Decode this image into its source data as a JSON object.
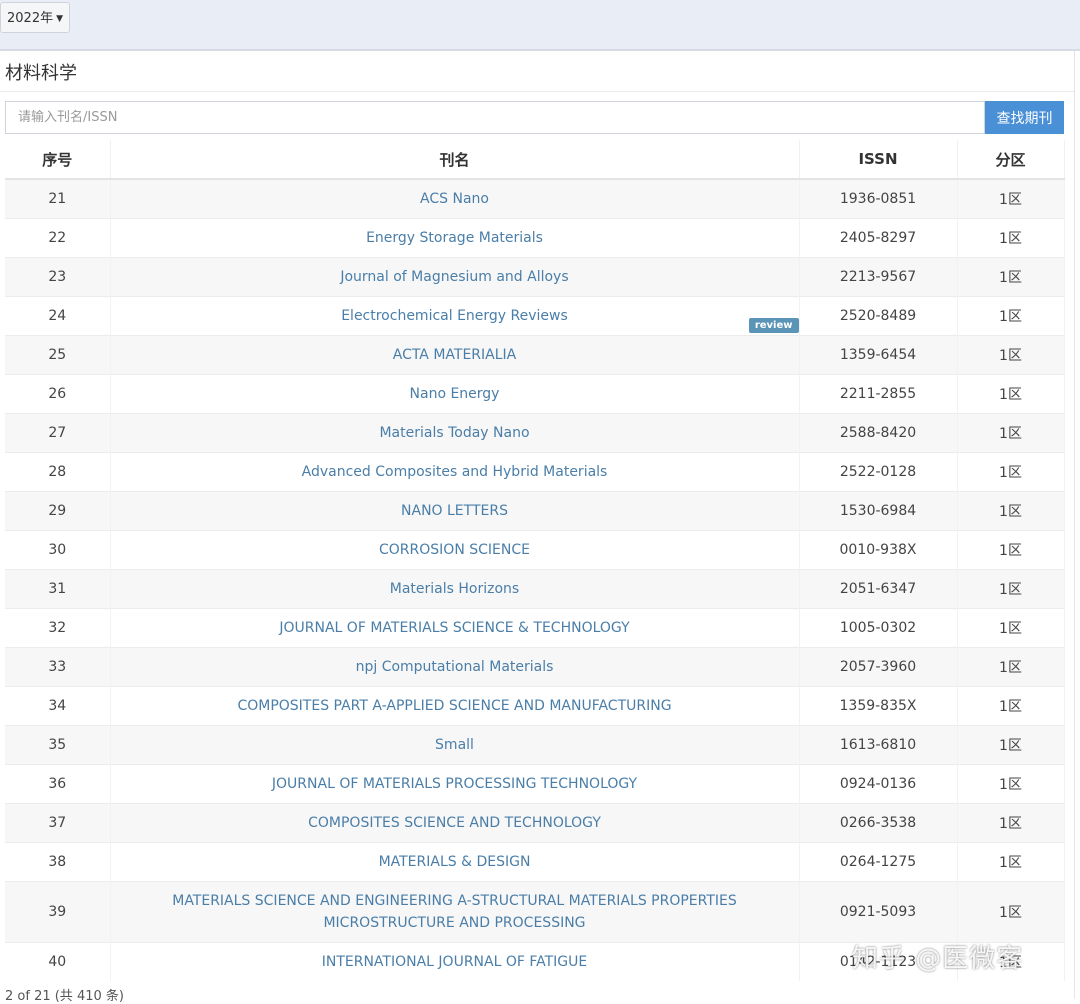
{
  "topbar": {
    "year_label": "2022年"
  },
  "panel": {
    "title": "材料科学"
  },
  "search": {
    "placeholder": "请输入刊名/ISSN",
    "button_label": "查找期刊"
  },
  "table": {
    "headers": {
      "index": "序号",
      "name": "刊名",
      "issn": "ISSN",
      "zone": "分区"
    },
    "rows": [
      {
        "index": "21",
        "name": "ACS Nano",
        "issn": "1936-0851",
        "zone": "1区"
      },
      {
        "index": "22",
        "name": "Energy Storage Materials",
        "issn": "2405-8297",
        "zone": "1区"
      },
      {
        "index": "23",
        "name": "Journal of Magnesium and Alloys",
        "issn": "2213-9567",
        "zone": "1区"
      },
      {
        "index": "24",
        "name": "Electrochemical Energy Reviews",
        "issn": "2520-8489",
        "zone": "1区",
        "badge": "review"
      },
      {
        "index": "25",
        "name": "ACTA MATERIALIA",
        "issn": "1359-6454",
        "zone": "1区"
      },
      {
        "index": "26",
        "name": "Nano Energy",
        "issn": "2211-2855",
        "zone": "1区"
      },
      {
        "index": "27",
        "name": "Materials Today Nano",
        "issn": "2588-8420",
        "zone": "1区"
      },
      {
        "index": "28",
        "name": "Advanced Composites and Hybrid Materials",
        "issn": "2522-0128",
        "zone": "1区"
      },
      {
        "index": "29",
        "name": "NANO LETTERS",
        "issn": "1530-6984",
        "zone": "1区"
      },
      {
        "index": "30",
        "name": "CORROSION SCIENCE",
        "issn": "0010-938X",
        "zone": "1区"
      },
      {
        "index": "31",
        "name": "Materials Horizons",
        "issn": "2051-6347",
        "zone": "1区"
      },
      {
        "index": "32",
        "name": "JOURNAL OF MATERIALS SCIENCE & TECHNOLOGY",
        "issn": "1005-0302",
        "zone": "1区"
      },
      {
        "index": "33",
        "name": "npj Computational Materials",
        "issn": "2057-3960",
        "zone": "1区"
      },
      {
        "index": "34",
        "name": "COMPOSITES PART A-APPLIED SCIENCE AND MANUFACTURING",
        "issn": "1359-835X",
        "zone": "1区"
      },
      {
        "index": "35",
        "name": "Small",
        "issn": "1613-6810",
        "zone": "1区"
      },
      {
        "index": "36",
        "name": "JOURNAL OF MATERIALS PROCESSING TECHNOLOGY",
        "issn": "0924-0136",
        "zone": "1区"
      },
      {
        "index": "37",
        "name": "COMPOSITES SCIENCE AND TECHNOLOGY",
        "issn": "0266-3538",
        "zone": "1区"
      },
      {
        "index": "38",
        "name": "MATERIALS & DESIGN",
        "issn": "0264-1275",
        "zone": "1区"
      },
      {
        "index": "39",
        "name": "MATERIALS SCIENCE AND ENGINEERING A-STRUCTURAL MATERIALS PROPERTIES MICROSTRUCTURE AND PROCESSING",
        "issn": "0921-5093",
        "zone": "1区"
      },
      {
        "index": "40",
        "name": "INTERNATIONAL JOURNAL OF FATIGUE",
        "issn": "0142-1123",
        "zone": "1区"
      }
    ]
  },
  "footer": {
    "pagination_text": "2 of 21 (共 410 条)"
  },
  "watermark": {
    "text": "知乎 @医微客"
  }
}
